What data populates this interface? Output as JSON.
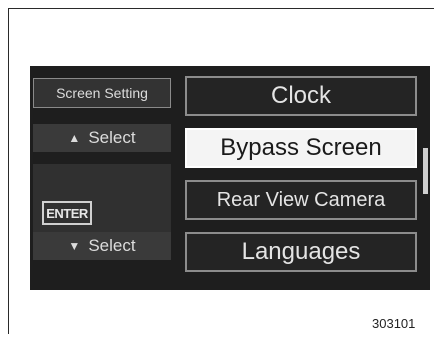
{
  "sidebar": {
    "screen_setting": "Screen Setting",
    "select_up": "Select",
    "enter": "ENTER",
    "select_down": "Select"
  },
  "menu": {
    "items": [
      {
        "label": "Clock",
        "selected": false
      },
      {
        "label": "Bypass Screen",
        "selected": true
      },
      {
        "label": "Rear View Camera",
        "selected": false
      },
      {
        "label": "Languages",
        "selected": false
      }
    ]
  },
  "figure_id": "303101"
}
